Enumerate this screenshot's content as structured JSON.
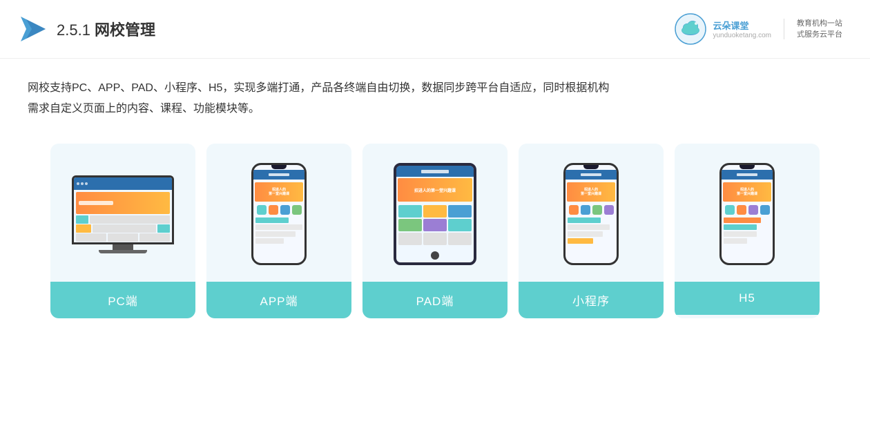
{
  "header": {
    "title_prefix": "2.5.1 ",
    "title_bold": "网校管理",
    "brand_name": "云朵课堂",
    "brand_url": "yunduoketang.com",
    "brand_subtitle_line1": "教育机构一站",
    "brand_subtitle_line2": "式服务云平台"
  },
  "description": {
    "text_line1": "网校支持PC、APP、PAD、小程序、H5，实现多端打通，产品各终端自由切换，数据同步跨平台自适应，同时根据机构",
    "text_line2": "需求自定义页面上的内容、课程、功能模块等。"
  },
  "cards": [
    {
      "id": "pc",
      "label": "PC端",
      "type": "pc"
    },
    {
      "id": "app",
      "label": "APP端",
      "type": "phone"
    },
    {
      "id": "pad",
      "label": "PAD端",
      "type": "tablet"
    },
    {
      "id": "miniapp",
      "label": "小程序",
      "type": "phone2"
    },
    {
      "id": "h5",
      "label": "H5",
      "type": "phone3"
    }
  ]
}
